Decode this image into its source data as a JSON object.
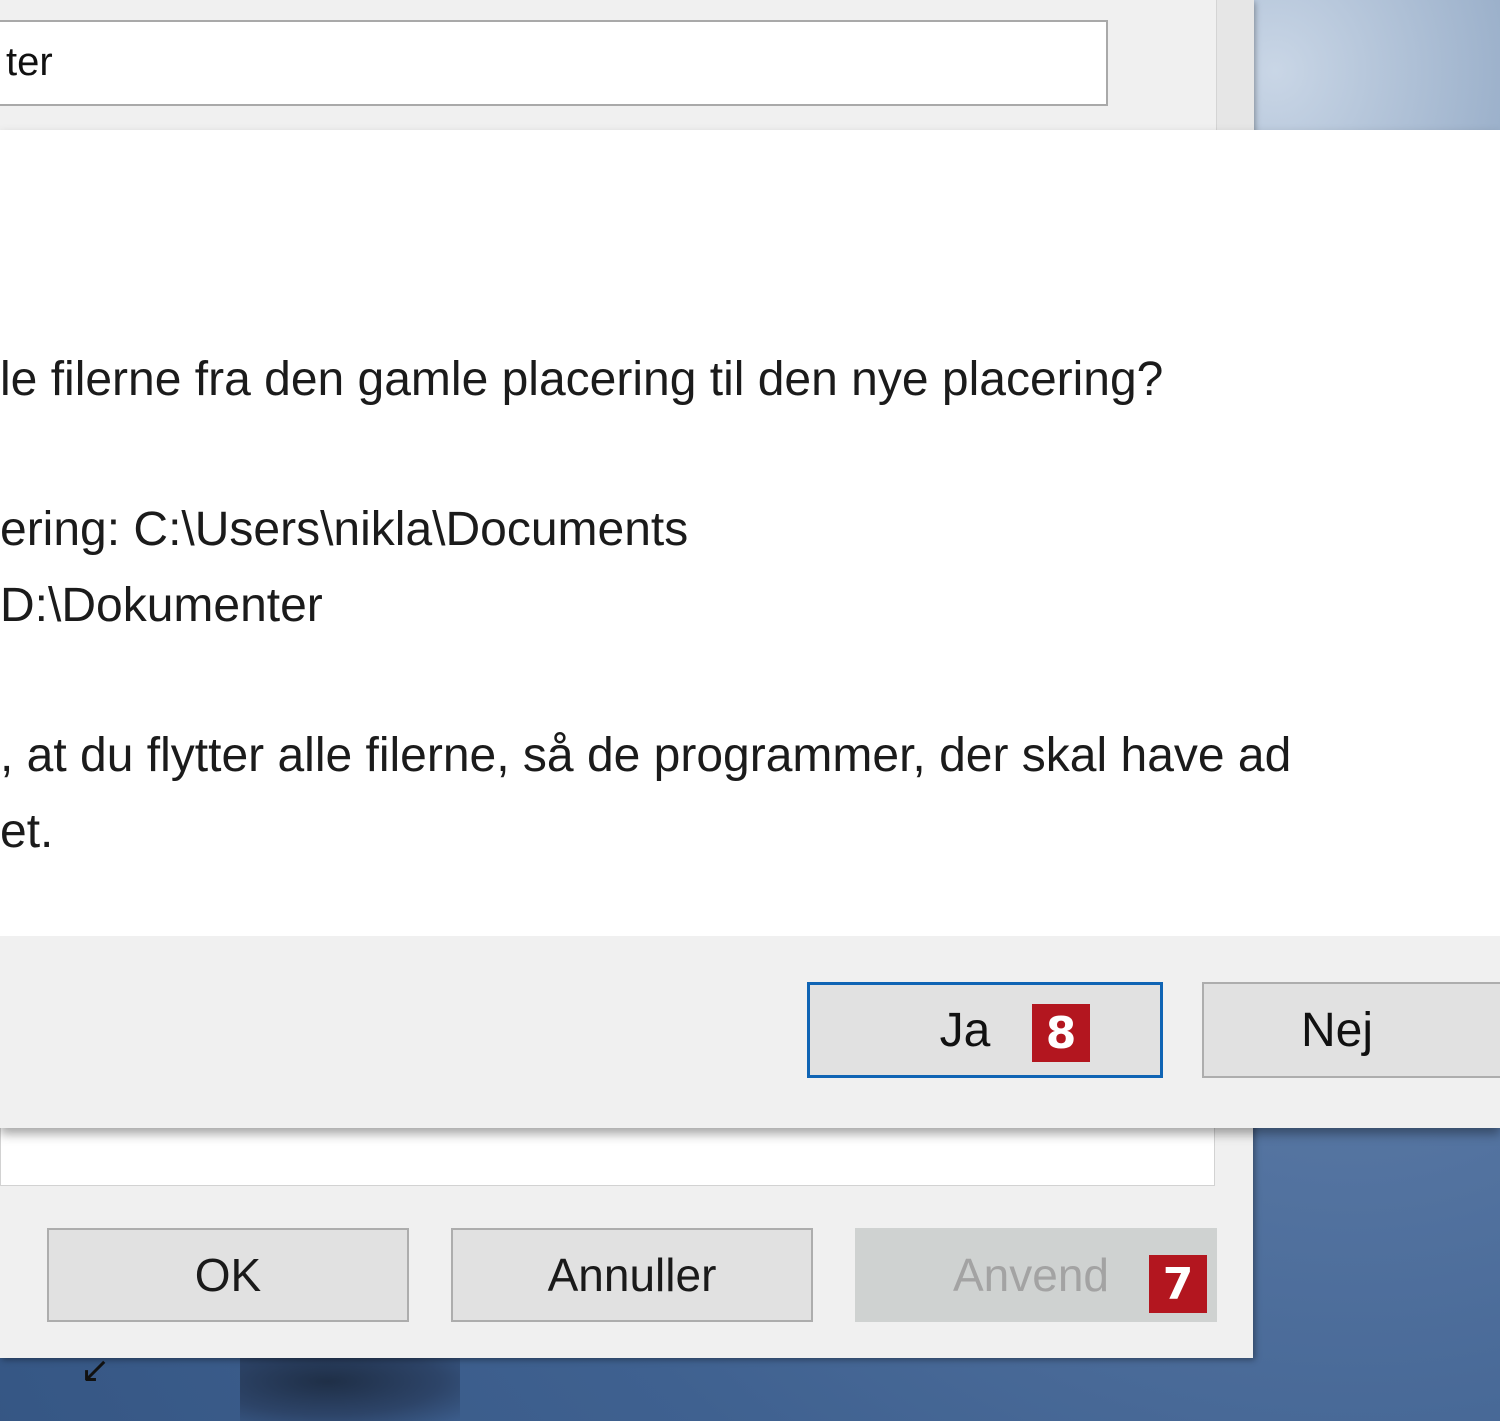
{
  "background_window": {
    "path_field_value": "ter",
    "buttons": {
      "ok": "OK",
      "cancel": "Annuller",
      "apply": "Anvend"
    },
    "shortcut_arrow": "↙"
  },
  "dialog": {
    "lines": [
      "le filerne fra den gamle placering til den nye placering?",
      "ering: C:\\Users\\nikla\\Documents",
      "D:\\Dokumenter",
      ", at du flytter alle filerne, så de programmer, der skal have ad",
      "et."
    ],
    "buttons": {
      "yes": "Ja",
      "no": "Nej"
    }
  },
  "badges": {
    "yes_step": "8",
    "apply_step": "7"
  },
  "colors": {
    "badge": "#b3161f",
    "default_button_border": "#0f64b4",
    "dialog_background": "#ffffff",
    "footer_background": "#f0f0f0"
  }
}
